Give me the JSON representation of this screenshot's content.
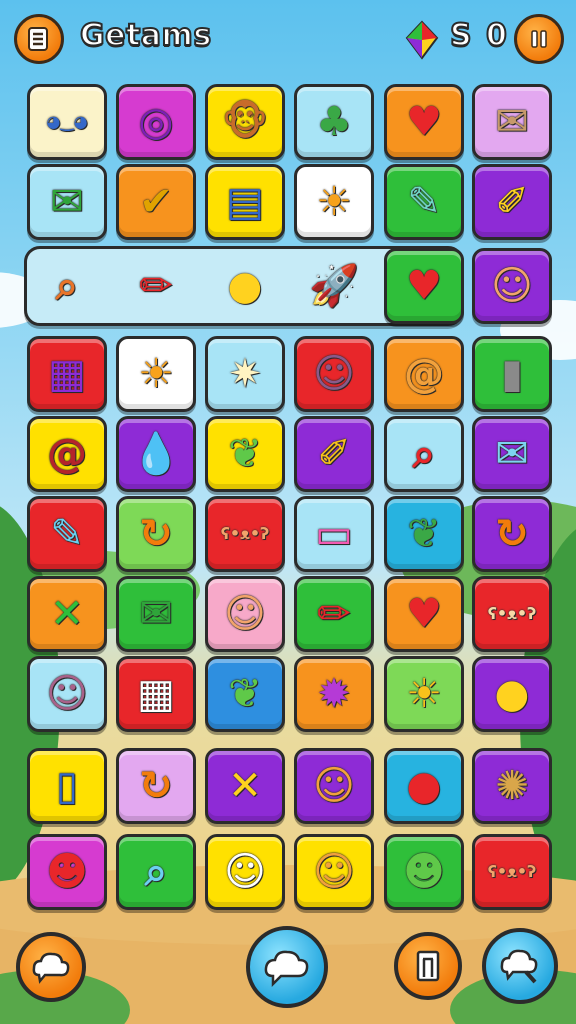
{
  "header": {
    "title": "Getams",
    "score": "S 0",
    "menu_icon": "menu-list-icon",
    "pause_icon": "pause-icon",
    "gem_icon": "rainbow-gem-icon"
  },
  "colors": {
    "orange": "#f7931e",
    "yellow": "#ffe100",
    "red": "#e8262a",
    "green": "#2fbf3a",
    "lime": "#7ed957",
    "purple": "#8e2bd6",
    "magenta": "#d63bd0",
    "cyan": "#a8e4f6",
    "teal": "#27b3e0",
    "cream": "#fbf3c9",
    "pink": "#f7a9c9",
    "lavender": "#e3a8f0",
    "white": "#ffffff",
    "blue": "#2e8fe0"
  },
  "board": {
    "rows": [
      [
        {
          "bg": "cream",
          "icon": "blue-monster-icon",
          "glyph": "◕‿◕",
          "fg": "#3468c9"
        },
        {
          "bg": "magenta",
          "icon": "target-icon",
          "glyph": "◎",
          "fg": "#7d1fb8"
        },
        {
          "bg": "yellow",
          "icon": "monkey-face-icon",
          "glyph": "🐵",
          "fg": "#c86c2a"
        },
        {
          "bg": "cyan",
          "icon": "green-octopus-icon",
          "glyph": "♣",
          "fg": "#3aa846"
        },
        {
          "bg": "orange",
          "icon": "heart-icon",
          "glyph": "♥",
          "fg": "#e8262a"
        },
        {
          "bg": "lavender",
          "icon": "envelope-icon",
          "glyph": "✉",
          "fg": "#c79a6b"
        }
      ],
      [
        {
          "bg": "cyan",
          "icon": "envelope-icon",
          "glyph": "✉",
          "fg": "#2fa53a"
        },
        {
          "bg": "orange",
          "icon": "checklist-icon",
          "glyph": "✔",
          "fg": "#e0a300"
        },
        {
          "bg": "yellow",
          "icon": "book-icon",
          "glyph": "▤",
          "fg": "#3468c9"
        },
        {
          "bg": "white",
          "icon": "sun-face-icon",
          "glyph": "☀",
          "fg": "#f7a21b"
        },
        {
          "bg": "green",
          "icon": "speech-bubble-icon",
          "glyph": "✎",
          "fg": "#6fd6c6"
        },
        {
          "bg": "purple",
          "icon": "pencil-note-icon",
          "glyph": "✐",
          "fg": "#ffd21f"
        }
      ],
      [
        {
          "bg": "band",
          "icon": "clipboard-search-icon",
          "glyph": "⌕",
          "fg": "#e8742a"
        },
        {
          "bg": "band",
          "icon": "pencil-icon",
          "glyph": "✏",
          "fg": "#e8262a"
        },
        {
          "bg": "band",
          "icon": "chat-bubble-icon",
          "glyph": "●",
          "fg": "#ffd21f"
        },
        {
          "bg": "band",
          "icon": "rocket-icon",
          "glyph": "🚀",
          "fg": "#3468c9"
        },
        {
          "bg": "green",
          "icon": "heart-icon",
          "glyph": "♥",
          "fg": "#e8262a"
        },
        {
          "bg": "purple",
          "icon": "lion-face-icon",
          "glyph": "☺",
          "fg": "#f2a46b"
        }
      ],
      [
        {
          "bg": "red",
          "icon": "chart-board-icon",
          "glyph": "▦",
          "fg": "#8e2bd6"
        },
        {
          "bg": "white",
          "icon": "sun-icon",
          "glyph": "☀",
          "fg": "#f7a21b"
        },
        {
          "bg": "cyan",
          "icon": "star-eye-icon",
          "glyph": "✷",
          "fg": "#fff4c2"
        },
        {
          "bg": "red",
          "icon": "monkey-face-icon",
          "glyph": "☺",
          "fg": "#8a5a8a"
        },
        {
          "bg": "orange",
          "icon": "spiral-icon",
          "glyph": "@",
          "fg": "#f2a13c"
        },
        {
          "bg": "green",
          "icon": "remote-icon",
          "glyph": "▮",
          "fg": "#8a8a8a"
        }
      ],
      [
        {
          "bg": "yellow",
          "icon": "spiral-icon",
          "glyph": "@",
          "fg": "#b5242a"
        },
        {
          "bg": "purple",
          "icon": "water-drop-icon",
          "glyph": "💧",
          "fg": "#4eb0f2"
        },
        {
          "bg": "yellow",
          "icon": "leaf-icon",
          "glyph": "❦",
          "fg": "#5fc949"
        },
        {
          "bg": "purple",
          "icon": "note-pencil-icon",
          "glyph": "✐",
          "fg": "#f7c21b"
        },
        {
          "bg": "cyan",
          "icon": "magnifier-star-icon",
          "glyph": "⌕",
          "fg": "#e8262a"
        },
        {
          "bg": "purple",
          "icon": "open-envelope-icon",
          "glyph": "✉",
          "fg": "#7dd4f0"
        }
      ],
      [
        {
          "bg": "red",
          "icon": "pencil-paper-icon",
          "glyph": "✎",
          "fg": "#6bd0f0"
        },
        {
          "bg": "lime",
          "icon": "swirl-icon",
          "glyph": "↻",
          "fg": "#f27c0c"
        },
        {
          "bg": "red",
          "icon": "bear-face-icon",
          "glyph": "ʕ•ᴥ•ʔ",
          "fg": "#f2a46b"
        },
        {
          "bg": "cyan",
          "icon": "sticky-note-icon",
          "glyph": "▭",
          "fg": "#f35ab3"
        },
        {
          "bg": "teal",
          "icon": "leaf-icon",
          "glyph": "❦",
          "fg": "#3aa846"
        },
        {
          "bg": "purple",
          "icon": "swirl-icon",
          "glyph": "↻",
          "fg": "#f27c0c"
        }
      ],
      [
        {
          "bg": "orange",
          "icon": "crossed-pencils-icon",
          "glyph": "✕",
          "fg": "#2fbf3a"
        },
        {
          "bg": "green",
          "icon": "envelope-icon",
          "glyph": "✉",
          "fg": "#2fa53a"
        },
        {
          "bg": "pink",
          "icon": "lion-face-icon",
          "glyph": "☺",
          "fg": "#f2a46b"
        },
        {
          "bg": "green",
          "icon": "pencil-icon",
          "glyph": "✏",
          "fg": "#e8262a"
        },
        {
          "bg": "orange",
          "icon": "heart-icon",
          "glyph": "♥",
          "fg": "#e8262a"
        },
        {
          "bg": "red",
          "icon": "bear-face-icon",
          "glyph": "ʕ•ᴥ•ʔ",
          "fg": "#f7d9a8"
        }
      ],
      [
        {
          "bg": "cyan",
          "icon": "monster-face-icon",
          "glyph": "☺",
          "fg": "#a8628a"
        },
        {
          "bg": "red",
          "icon": "calendar-icon",
          "glyph": "▦",
          "fg": "#ffffff"
        },
        {
          "bg": "blue",
          "icon": "leaf-icon",
          "glyph": "❦",
          "fg": "#5fc949"
        },
        {
          "bg": "orange",
          "icon": "star-creature-icon",
          "glyph": "✹",
          "fg": "#b53ad6"
        },
        {
          "bg": "lime",
          "icon": "sun-icon",
          "glyph": "☀",
          "fg": "#f7c21b"
        },
        {
          "bg": "purple",
          "icon": "chat-bubble-icon",
          "glyph": "●",
          "fg": "#ffd21f"
        }
      ],
      [
        {
          "bg": "yellow",
          "icon": "bottle-icon",
          "glyph": "▯",
          "fg": "#3468c9"
        },
        {
          "bg": "lavender",
          "icon": "swirl-icon",
          "glyph": "↻",
          "fg": "#f27c0c"
        },
        {
          "bg": "purple",
          "icon": "crossed-pencils-icon",
          "glyph": "✕",
          "fg": "#ffd21f"
        },
        {
          "bg": "purple",
          "icon": "robot-face-icon",
          "glyph": "☺",
          "fg": "#f2a13c"
        },
        {
          "bg": "teal",
          "icon": "balloon-icon",
          "glyph": "●",
          "fg": "#e8262a"
        },
        {
          "bg": "purple",
          "icon": "turtle-icon",
          "glyph": "✺",
          "fg": "#d9a64a"
        }
      ],
      [
        {
          "bg": "magenta",
          "icon": "blob-monster-icon",
          "glyph": "☻",
          "fg": "#e8262a"
        },
        {
          "bg": "green",
          "icon": "fish-magnifier-icon",
          "glyph": "⌕",
          "fg": "#6bd0f0"
        },
        {
          "bg": "yellow",
          "icon": "cat-face-icon",
          "glyph": "☺",
          "fg": "#ffffff"
        },
        {
          "bg": "yellow",
          "icon": "monkey-face-icon",
          "glyph": "☺",
          "fg": "#f2a13c"
        },
        {
          "bg": "green",
          "icon": "slime-monster-icon",
          "glyph": "☻",
          "fg": "#5fc949"
        },
        {
          "bg": "red",
          "icon": "bear-face-icon",
          "glyph": "ʕ•ᴥ•ʔ",
          "fg": "#f2a46b"
        }
      ]
    ]
  },
  "footer": {
    "left_icon": "cloud-chat-icon",
    "center_icon": "speech-cloud-icon",
    "right1_icon": "door-icon",
    "right2_icon": "search-chat-icon"
  }
}
